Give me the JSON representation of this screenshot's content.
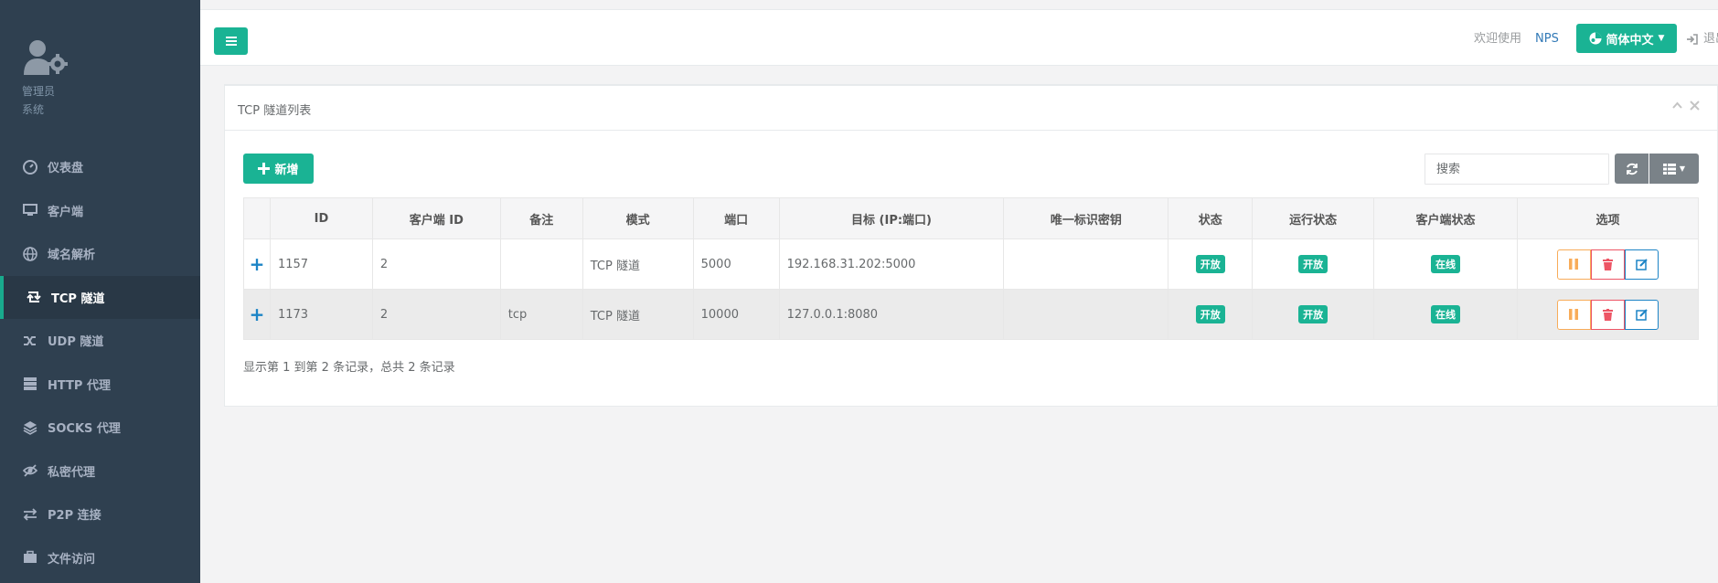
{
  "profile": {
    "role": "管理员",
    "system": "系统"
  },
  "nav": [
    {
      "label": "仪表盘",
      "icon": "dashboard-icon"
    },
    {
      "label": "客户端",
      "icon": "desktop-icon"
    },
    {
      "label": "域名解析",
      "icon": "globe-icon"
    },
    {
      "label": "TCP 隧道",
      "icon": "retweet-icon",
      "active": true
    },
    {
      "label": "UDP 隧道",
      "icon": "random-icon"
    },
    {
      "label": "HTTP 代理",
      "icon": "server-icon"
    },
    {
      "label": "SOCKS 代理",
      "icon": "layers-icon"
    },
    {
      "label": "私密代理",
      "icon": "eye-slash-icon"
    },
    {
      "label": "P2P 连接",
      "icon": "exchange-icon"
    },
    {
      "label": "文件访问",
      "icon": "briefcase-icon"
    }
  ],
  "topbar": {
    "welcome": "欢迎使用",
    "brand": "NPS",
    "language": "简体中文",
    "logout": "退出"
  },
  "panel": {
    "title": "TCP 隧道列表"
  },
  "toolbar": {
    "add_label": "新增",
    "search_placeholder": "搜索"
  },
  "table": {
    "headers": [
      "",
      "ID",
      "客户端 ID",
      "备注",
      "模式",
      "端口",
      "目标 (IP:端口)",
      "唯一标识密钥",
      "状态",
      "运行状态",
      "客户端状态",
      "选项"
    ],
    "rows": [
      {
        "expand": "+",
        "id": "1157",
        "client_id": "2",
        "remark": "",
        "mode": "TCP 隧道",
        "port": "5000",
        "target": "192.168.31.202:5000",
        "key": "",
        "status": "开放",
        "run_status": "开放",
        "client_status": "在线"
      },
      {
        "expand": "+",
        "id": "1173",
        "client_id": "2",
        "remark": "tcp",
        "mode": "TCP 隧道",
        "port": "10000",
        "target": "127.0.0.1:8080",
        "key": "",
        "status": "开放",
        "run_status": "开放",
        "client_status": "在线"
      }
    ]
  },
  "footer": {
    "info": "显示第 1 到第 2 条记录，总共 2 条记录"
  },
  "colors": {
    "sidebar": "#2f4050",
    "primary": "#1ab394",
    "warning": "#f8ac59",
    "danger": "#ed5565",
    "info": "#1c84c6"
  }
}
